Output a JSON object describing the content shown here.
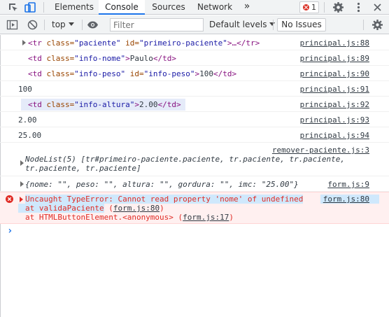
{
  "tabbar": {
    "tabs": [
      "Elements",
      "Console",
      "Sources",
      "Network"
    ],
    "more": "»",
    "error_count": "1"
  },
  "toolbar": {
    "context": "top",
    "filter_placeholder": "Filter",
    "levels": "Default levels",
    "issues": "No Issues"
  },
  "log": {
    "r1": {
      "tag_open": "<tr ",
      "a1": "class=",
      "v1": "\"paciente\"",
      "a2": " id=",
      "v2": "\"primeiro-paciente\"",
      "tail": ">…</tr>",
      "src": "principal.js:88"
    },
    "r2": {
      "tag_open": "<td ",
      "a1": "class=",
      "v1": "\"info-nome\"",
      "gt": ">",
      "text": "Paulo",
      "close": "</td>",
      "src": "principal.js:89"
    },
    "r3": {
      "tag_open": "<td ",
      "a1": "class=",
      "v1": "\"info-peso\"",
      "a2": " id=",
      "v2": "\"info-peso\"",
      "gt": ">",
      "text": "100",
      "close": "</td>",
      "src": "principal.js:90"
    },
    "r4": {
      "text": "100",
      "src": "principal.js:91"
    },
    "r5": {
      "tag_open": "<td ",
      "a1": "class=",
      "v1": "\"info-altura\"",
      "gt": ">",
      "text": "2.00",
      "close": "</td>",
      "src": "principal.js:92"
    },
    "r6": {
      "text": "2.00",
      "src": "principal.js:93"
    },
    "r7": {
      "text": "25.00",
      "src": "principal.js:94"
    },
    "r8": {
      "src": "remover-paciente.js:3",
      "line1": "NodeList(5) [tr#primeiro-paciente.paciente, tr.paciente, tr.paciente,",
      "line2": "tr.paciente, tr.paciente]"
    },
    "r9": {
      "text": "{nome: \"\", peso: \"\", altura: \"\", gordura: \"\", imc: \"25.00\"}",
      "src": "form.js:9"
    },
    "r10": {
      "line1": "Uncaught TypeError: Cannot read property 'nome' of undefined",
      "line2a": "    at validaPaciente",
      "line2b_open": " (",
      "line2b_link": "form.js:80",
      "line2b_close": ")",
      "line3a": "    at HTMLButtonElement.<anonymous>",
      "line3b_open": " (",
      "line3b_link": "form.js:17",
      "line3b_close": ")",
      "src": "form.js:80"
    }
  },
  "prompt": "›"
}
